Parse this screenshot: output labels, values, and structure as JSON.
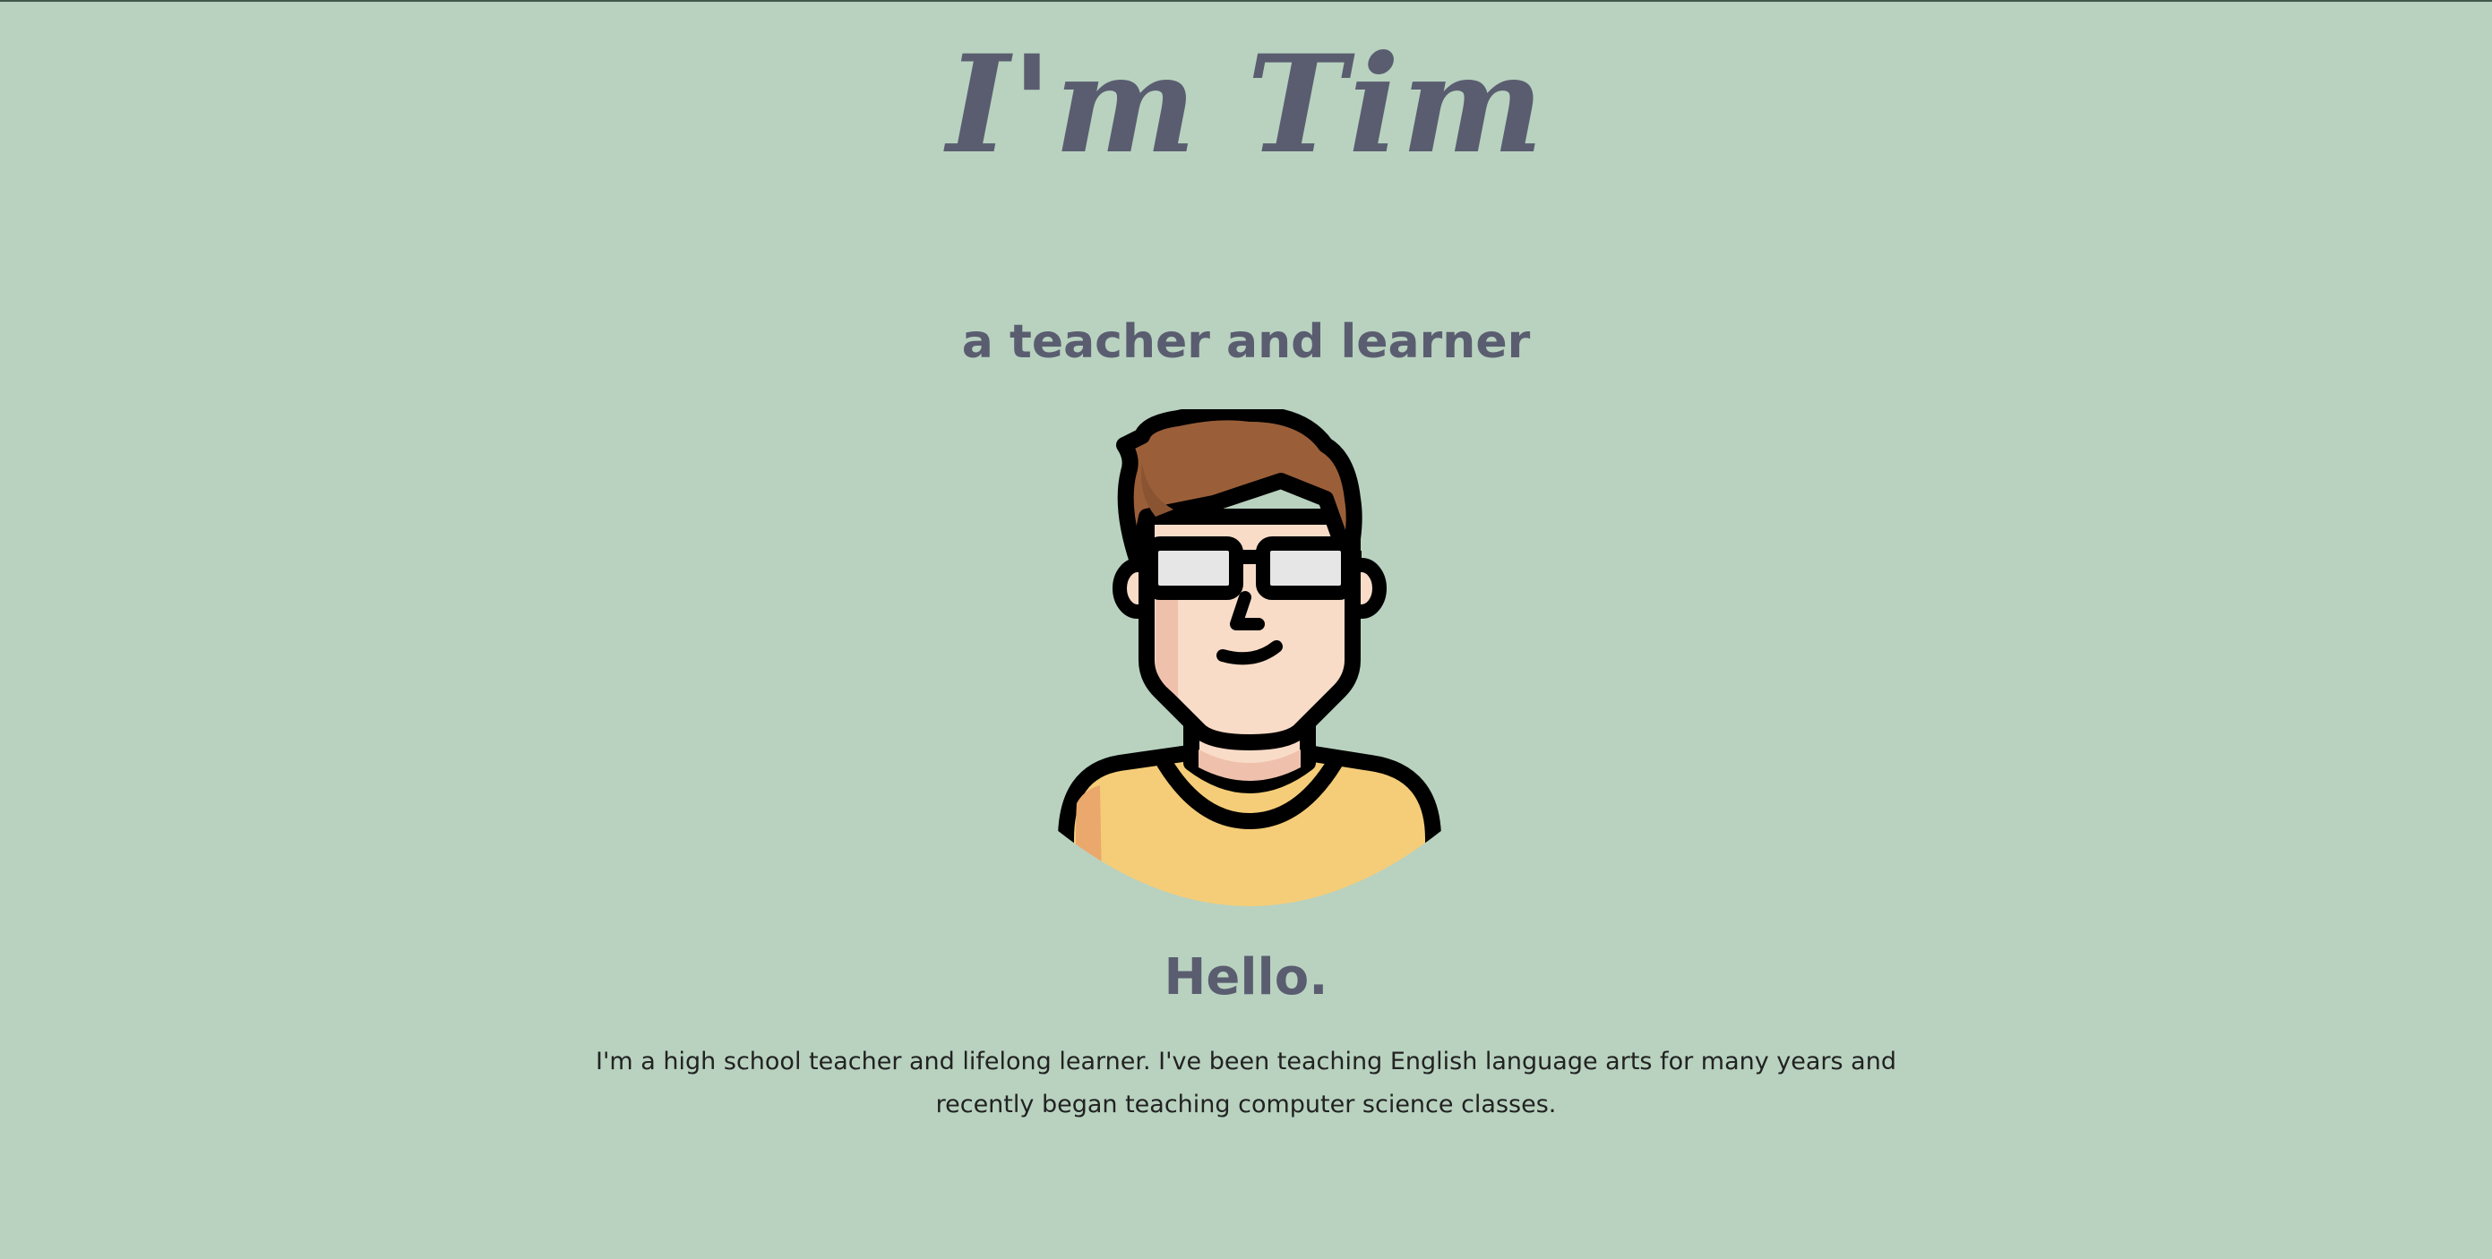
{
  "header": {
    "title": "I'm Tim",
    "subtitle": "a teacher and learner"
  },
  "avatar": {
    "icon": "teacher-avatar-icon",
    "colors": {
      "background": "#b8d2bf",
      "hair": "#9a5f39",
      "skin": "#f9dcc8",
      "shirt": "#f5cd78",
      "outline": "#000000",
      "lens": "#e6e6e6"
    }
  },
  "intro": {
    "heading": "Hello.",
    "text": "I'm a high school teacher and lifelong learner. I've been teaching English language arts for many years and recently began teaching computer science classes."
  }
}
